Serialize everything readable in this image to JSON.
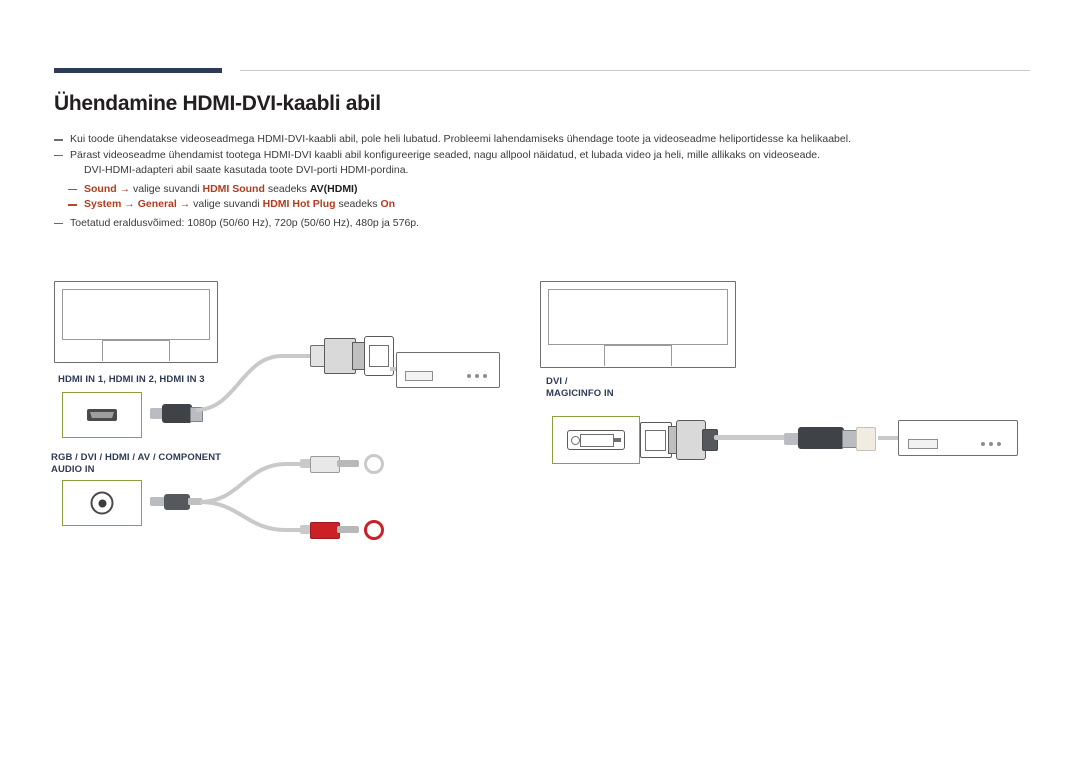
{
  "document": {
    "title": "Ühendamine HDMI-DVI-kaabli abil",
    "notes": [
      {
        "id": "note-1",
        "text": "Kui toode ühendatakse videoseadmega HDMI-DVI-kaabli abil, pole heli lubatud. Probleemi lahendamiseks ühendage toote ja videoseadme heliportidesse ka helikaabel."
      },
      {
        "id": "note-2",
        "text": "Pärast videoseadme ühendamist tootega HDMI-DVI kaabli abil konfigureerige seaded, nagu allpool näidatud, et lubada video ja heli, mille allikaks on videoseade."
      }
    ],
    "note_sub": "DVI-HDMI-adapteri abil saate kasutada toote DVI-porti HDMI-pordina.",
    "menu_paths": [
      {
        "id": "menu-path-sound",
        "root": "Sound",
        "arrow": "→",
        "mid": "valige suvandi",
        "setting": "HDMI Sound",
        "verb": "seadeks",
        "value": "AV(HDMI)"
      },
      {
        "id": "menu-path-system",
        "root": "System",
        "arrow": "→",
        "second": "General",
        "arrow2": "→",
        "mid": "valige suvandi",
        "setting": "HDMI Hot Plug",
        "verb": "seadeks",
        "value": "On"
      }
    ],
    "note_resolution": "Toetatud eraldusvõimed: 1080p (50/60 Hz), 720p (50/60 Hz), 480p ja 576p."
  },
  "diagram": {
    "left": {
      "display_name": "display-panel",
      "port_labels": {
        "hdmi": "HDMI IN 1, HDMI IN 2, HDMI IN 3",
        "audio": "RGB / DVI / HDMI / AV / COMPONENT\nAUDIO IN"
      },
      "icons": {
        "hdmi_port": "hdmi-port-icon",
        "audio_port": "audio-jack-port-icon",
        "hdmi_plug": "hdmi-male-plug-icon",
        "dvi_plug": "dvi-male-plug-icon",
        "rca_white": "rca-plug-white-icon",
        "rca_red": "rca-plug-red-icon",
        "mini_plug": "stereo-mini-plug-icon",
        "video_device": "video-device-icon"
      },
      "colors": {
        "rca_white": "#e8e8e8",
        "rca_red": "#cc2027",
        "port_box_border": "#8aa03c",
        "label": "#2e3b55"
      }
    },
    "right": {
      "display_name": "display-panel",
      "port_labels": {
        "dvi": "DVI /\nMAGICINFO IN"
      },
      "icons": {
        "dvi_port": "dvi-port-icon",
        "dvi_plug": "dvi-male-plug-icon",
        "hdmi_plug": "hdmi-male-plug-icon",
        "video_device": "video-device-icon"
      }
    }
  },
  "theme": {
    "accent_bar": "#2e3b55",
    "menu_red": "#b23c1f",
    "port_green": "#8aa03c",
    "label_navy": "#2e3b55"
  }
}
